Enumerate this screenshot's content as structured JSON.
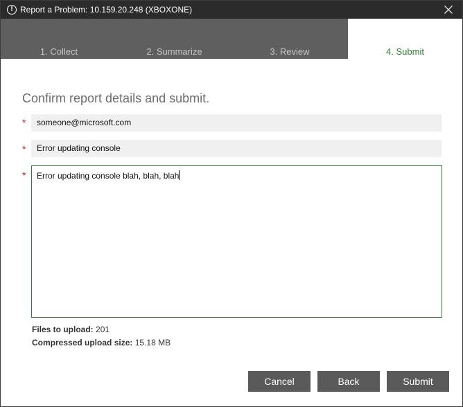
{
  "window": {
    "title": "Report a Problem: 10.159.20.248 (XBOXONE)",
    "title_icon": "!",
    "close_icon": "close-icon"
  },
  "tabs": [
    {
      "label": "1. Collect",
      "active": false
    },
    {
      "label": "2. Summarize",
      "active": false
    },
    {
      "label": "3. Review",
      "active": false
    },
    {
      "label": "4. Submit",
      "active": true
    }
  ],
  "form": {
    "heading": "Confirm report details and submit.",
    "required_marker": "*",
    "email_value": "someone@microsoft.com",
    "summary_value": "Error updating console",
    "description_value": "Error updating console blah, blah, blah"
  },
  "upload": {
    "files_label": "Files to upload:",
    "files_value": "201",
    "size_label": "Compressed upload size:",
    "size_value": "15.18 MB"
  },
  "buttons": {
    "cancel": "Cancel",
    "back": "Back",
    "submit": "Submit"
  },
  "colors": {
    "accent": "#2e7d32",
    "required": "#d62020",
    "button_bg": "#5a5a5a",
    "tab_inactive_bg": "#5f5f5f",
    "titlebar_bg": "#2b2b2b"
  }
}
